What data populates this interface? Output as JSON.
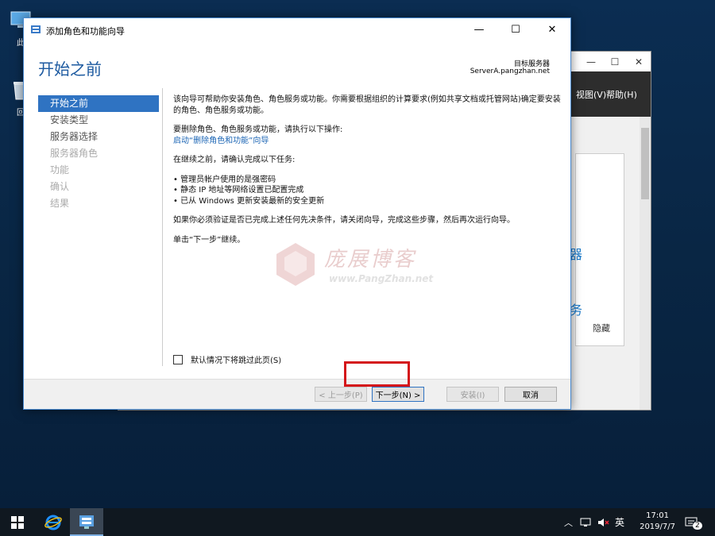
{
  "desktop": {
    "icons": [
      {
        "label": "此",
        "icon": "computer-icon"
      },
      {
        "label": "回",
        "icon": "recycle-bin-icon"
      }
    ]
  },
  "background_window": {
    "menu": [
      "视图(V)",
      "帮助(H)"
    ],
    "fragments": [
      "器",
      "务"
    ],
    "hide_label": "隐藏"
  },
  "wizard": {
    "title": "添加角色和功能向导",
    "heading": "开始之前",
    "destination_label": "目标服务器",
    "destination_server": "ServerA.pangzhan.net",
    "nav": [
      {
        "label": "开始之前",
        "state": "active"
      },
      {
        "label": "安装类型",
        "state": "normal"
      },
      {
        "label": "服务器选择",
        "state": "normal"
      },
      {
        "label": "服务器角色",
        "state": "disabled"
      },
      {
        "label": "功能",
        "state": "disabled"
      },
      {
        "label": "确认",
        "state": "disabled"
      },
      {
        "label": "结果",
        "state": "disabled"
      }
    ],
    "content": {
      "intro": "该向导可帮助你安装角色、角色服务或功能。你需要根据组织的计算要求(例如共享文档或托管网站)确定要安装的角色、角色服务或功能。",
      "remove_prompt": "要删除角色、角色服务或功能，请执行以下操作:",
      "remove_link": "启动“删除角色和功能”向导",
      "before_continue": "在继续之前，请确认完成以下任务:",
      "tasks": [
        "管理员帐户使用的是强密码",
        "静态 IP 地址等网络设置已配置完成",
        "已从 Windows 更新安装最新的安全更新"
      ],
      "verify": "如果你必须验证是否已完成上述任何先决条件，请关闭向导，完成这些步骤，然后再次运行向导。",
      "click_next": "单击“下一步”继续。"
    },
    "skip_checkbox": {
      "label": "默认情况下将跳过此页(S)",
      "checked": false
    },
    "buttons": {
      "prev": "< 上一步(P)",
      "next": "下一步(N) >",
      "install": "安装(I)",
      "cancel": "取消"
    }
  },
  "watermark": {
    "text": "庞展博客",
    "url": "www.PangZhan.net"
  },
  "taskbar": {
    "ime": "英",
    "time": "17:01",
    "date": "2019/7/7",
    "notification_count": "2"
  },
  "colors": {
    "accent": "#2f73c2",
    "heading": "#1d5aa0",
    "highlight": "#d4151a",
    "link": "#1a64b4"
  }
}
